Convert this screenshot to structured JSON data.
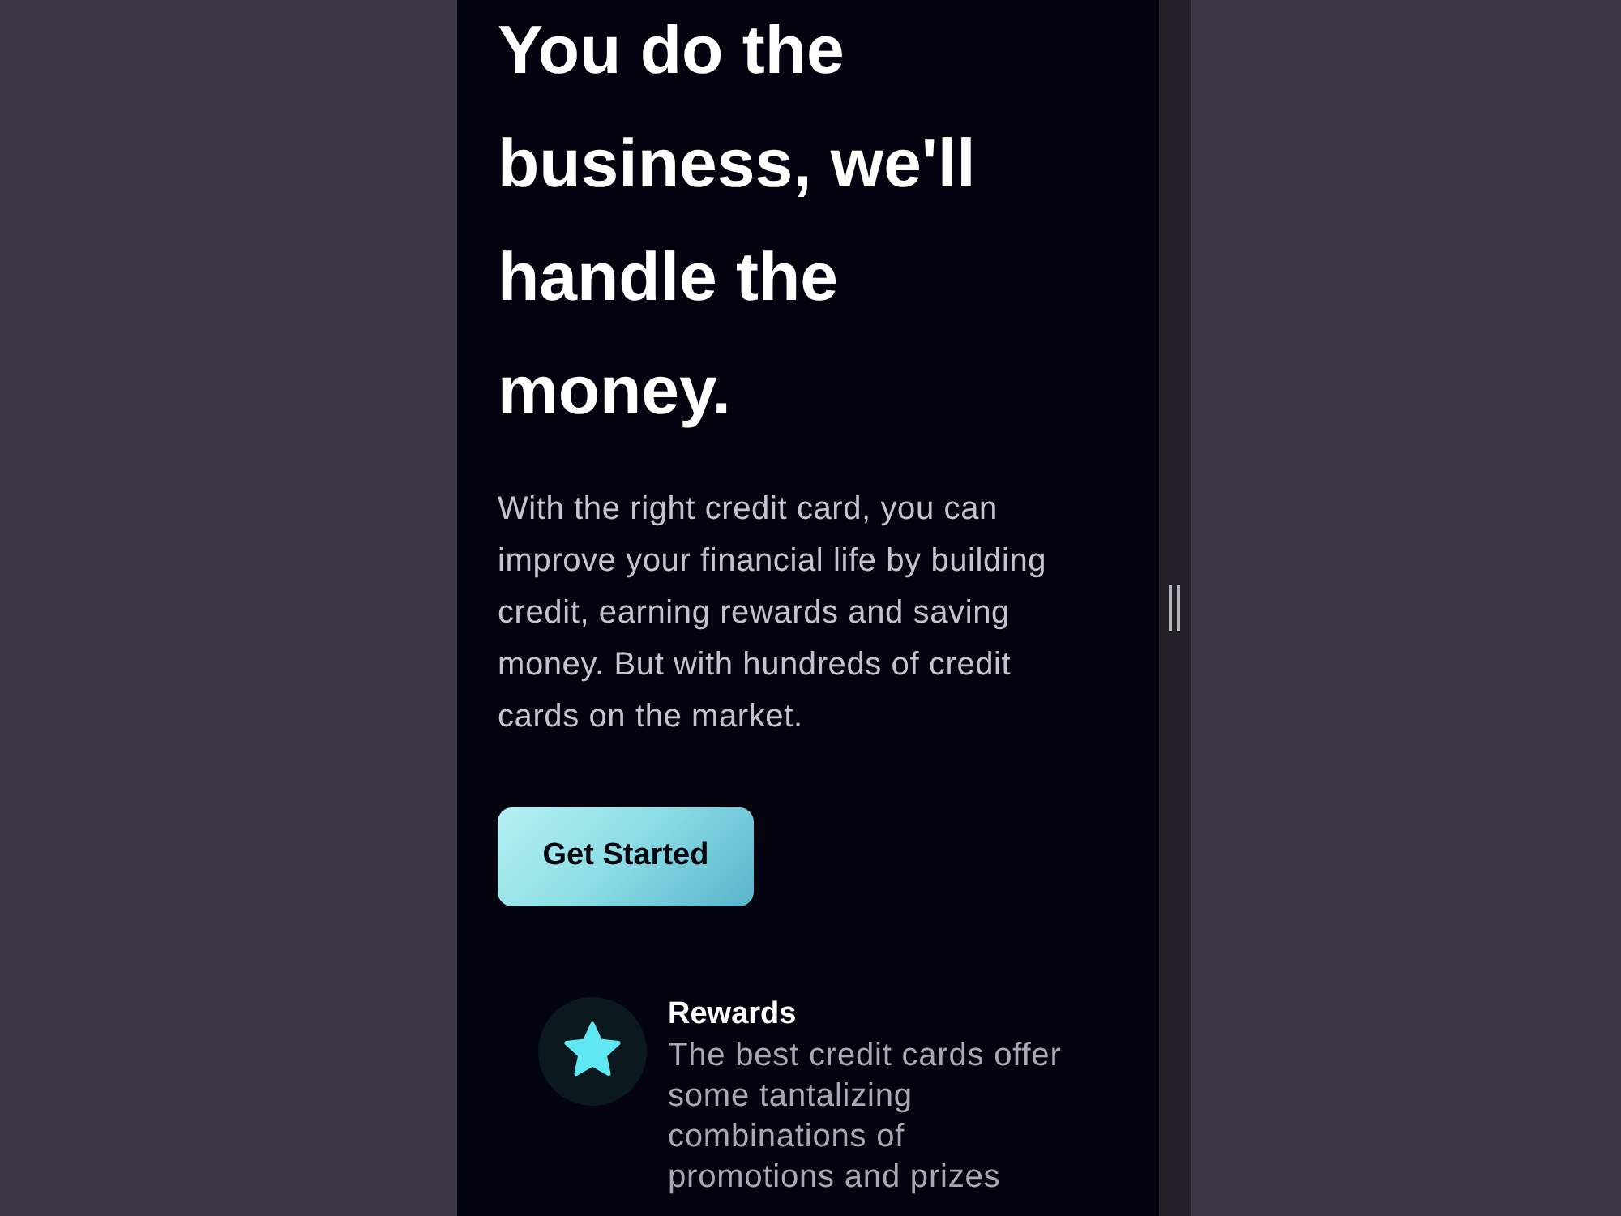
{
  "hero": {
    "heading": "You do the business, we'll handle the money.",
    "text": "With the right credit card, you can improve your financial life by building credit, earning rewards and saving money. But with hundreds of credit cards on the market.",
    "button": "Get Started"
  },
  "features": [
    {
      "title": "Rewards",
      "text": "The best credit cards offer some tantalizing combinations of promotions and prizes"
    }
  ]
}
